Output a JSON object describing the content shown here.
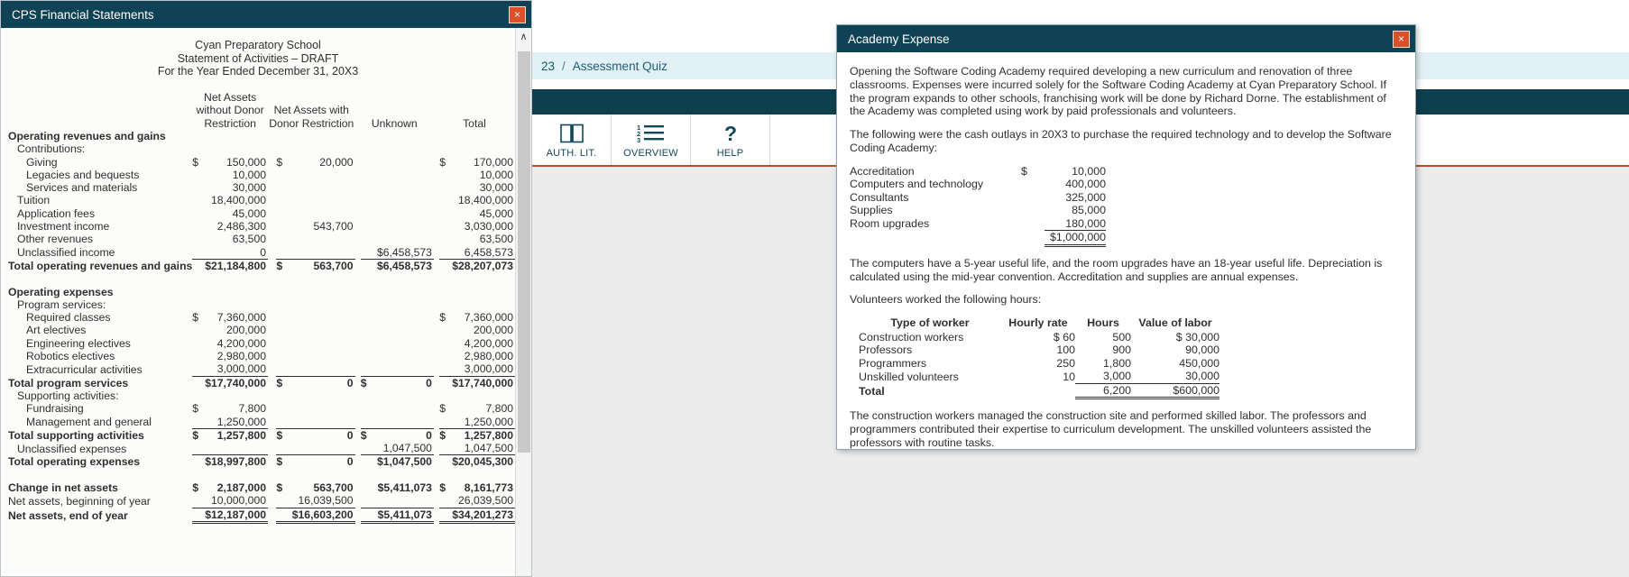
{
  "background_app": {
    "breadcrumb": {
      "prefix": "23",
      "separator": "/",
      "current": "Assessment Quiz"
    },
    "toolbar": {
      "buttons": [
        {
          "icon": "open-book-icon",
          "label": "AUTH. LIT."
        },
        {
          "icon": "numbered-list-icon",
          "label": "OVERVIEW"
        },
        {
          "icon": "question-mark-icon",
          "label": "HELP"
        }
      ]
    },
    "accent_color": "#b8522a",
    "navbar_color": "#0d3f4f"
  },
  "financial_window": {
    "title": "CPS Financial Statements",
    "close_label": "×",
    "scroll_up_glyph": "∧",
    "heading": [
      "Cyan Preparatory School",
      "Statement of Activities – DRAFT",
      "For the Year Ended December 31, 20X3"
    ],
    "column_headers": {
      "col1_line1": "Net Assets",
      "col1_line2": "without Donor",
      "col1_line3": "Restriction",
      "col2_line2": "Net Assets with",
      "col2_line3": "Donor Restriction",
      "col3": "Unknown",
      "col4": "Total"
    },
    "rows": [
      {
        "type": "section",
        "label": "Operating revenues and gains",
        "indent": 0,
        "bold": true
      },
      {
        "type": "sub",
        "label": "Contributions:",
        "indent": 1,
        "bold": false
      },
      {
        "type": "data",
        "label": "Giving",
        "indent": 2,
        "bold": false,
        "c1_sym": "$",
        "c1": "150,000",
        "c2_sym": "$",
        "c2": "20,000",
        "c3_sym": "",
        "c3": "",
        "c4_sym": "$",
        "c4": "170,000"
      },
      {
        "type": "data",
        "label": "Legacies and bequests",
        "indent": 2,
        "bold": false,
        "c1_sym": "",
        "c1": "10,000",
        "c2_sym": "",
        "c2": "",
        "c3_sym": "",
        "c3": "",
        "c4_sym": "",
        "c4": "10,000"
      },
      {
        "type": "data",
        "label": "Services and materials",
        "indent": 2,
        "bold": false,
        "c1_sym": "",
        "c1": "30,000",
        "c2_sym": "",
        "c2": "",
        "c3_sym": "",
        "c3": "",
        "c4_sym": "",
        "c4": "30,000"
      },
      {
        "type": "data",
        "label": "Tuition",
        "indent": 1,
        "bold": false,
        "c1_sym": "",
        "c1": "18,400,000",
        "c2_sym": "",
        "c2": "",
        "c3_sym": "",
        "c3": "",
        "c4_sym": "",
        "c4": "18,400,000"
      },
      {
        "type": "data",
        "label": "Application fees",
        "indent": 1,
        "bold": false,
        "c1_sym": "",
        "c1": "45,000",
        "c2_sym": "",
        "c2": "",
        "c3_sym": "",
        "c3": "",
        "c4_sym": "",
        "c4": "45,000"
      },
      {
        "type": "data",
        "label": "Investment income",
        "indent": 1,
        "bold": false,
        "c1_sym": "",
        "c1": "2,486,300",
        "c2_sym": "",
        "c2": "543,700",
        "c3_sym": "",
        "c3": "",
        "c4_sym": "",
        "c4": "3,030,000"
      },
      {
        "type": "data",
        "label": "Other revenues",
        "indent": 1,
        "bold": false,
        "c1_sym": "",
        "c1": "63,500",
        "c2_sym": "",
        "c2": "",
        "c3_sym": "",
        "c3": "",
        "c4_sym": "",
        "c4": "63,500"
      },
      {
        "type": "data",
        "label": "Unclassified income",
        "indent": 1,
        "bold": false,
        "rule": "below",
        "c1_sym": "",
        "c1": "0",
        "c2_sym": "",
        "c2": "",
        "c3_sym": "",
        "c3": "$6,458,573",
        "c4_sym": "",
        "c4": "6,458,573"
      },
      {
        "type": "total",
        "label": "Total operating revenues and gains",
        "indent": 0,
        "bold": true,
        "rule": "top",
        "c1_sym": "",
        "c1": "$21,184,800",
        "c2_sym": "$",
        "c2": "563,700",
        "c3_sym": "",
        "c3": "$6,458,573",
        "c4_sym": "",
        "c4": "$28,207,073"
      },
      {
        "type": "spacer"
      },
      {
        "type": "section",
        "label": "Operating expenses",
        "indent": 0,
        "bold": true
      },
      {
        "type": "sub",
        "label": "Program services:",
        "indent": 1,
        "bold": false
      },
      {
        "type": "data",
        "label": "Required classes",
        "indent": 2,
        "bold": false,
        "c1_sym": "$",
        "c1": "7,360,000",
        "c2_sym": "",
        "c2": "",
        "c3_sym": "",
        "c3": "",
        "c4_sym": "$",
        "c4": "7,360,000"
      },
      {
        "type": "data",
        "label": "Art electives",
        "indent": 2,
        "bold": false,
        "c1_sym": "",
        "c1": "200,000",
        "c2_sym": "",
        "c2": "",
        "c3_sym": "",
        "c3": "",
        "c4_sym": "",
        "c4": "200,000"
      },
      {
        "type": "data",
        "label": "Engineering electives",
        "indent": 2,
        "bold": false,
        "c1_sym": "",
        "c1": "4,200,000",
        "c2_sym": "",
        "c2": "",
        "c3_sym": "",
        "c3": "",
        "c4_sym": "",
        "c4": "4,200,000"
      },
      {
        "type": "data",
        "label": "Robotics electives",
        "indent": 2,
        "bold": false,
        "c1_sym": "",
        "c1": "2,980,000",
        "c2_sym": "",
        "c2": "",
        "c3_sym": "",
        "c3": "",
        "c4_sym": "",
        "c4": "2,980,000"
      },
      {
        "type": "data",
        "label": "Extracurricular activities",
        "indent": 2,
        "bold": false,
        "c1_sym": "",
        "c1": "3,000,000",
        "c2_sym": "",
        "c2": "",
        "c3_sym": "",
        "c3": "",
        "c4_sym": "",
        "c4": "3,000,000"
      },
      {
        "type": "total",
        "label": "Total program services",
        "indent": 0,
        "bold": true,
        "rule": "top",
        "c1_sym": "",
        "c1": "$17,740,000",
        "c2_sym": "$",
        "c2": "0",
        "c3_sym": "$",
        "c3": "0",
        "c4_sym": "",
        "c4": "$17,740,000"
      },
      {
        "type": "sub",
        "label": "Supporting activities:",
        "indent": 1,
        "bold": false
      },
      {
        "type": "data",
        "label": "Fundraising",
        "indent": 2,
        "bold": false,
        "c1_sym": "$",
        "c1": "7,800",
        "c2_sym": "",
        "c2": "",
        "c3_sym": "",
        "c3": "",
        "c4_sym": "$",
        "c4": "7,800"
      },
      {
        "type": "data",
        "label": "Management and general",
        "indent": 2,
        "bold": false,
        "c1_sym": "",
        "c1": "1,250,000",
        "c2_sym": "",
        "c2": "",
        "c3_sym": "",
        "c3": "",
        "c4_sym": "",
        "c4": "1,250,000"
      },
      {
        "type": "total",
        "label": "Total supporting activities",
        "indent": 0,
        "bold": true,
        "rule": "top",
        "c1_sym": "$",
        "c1": "1,257,800",
        "c2_sym": "$",
        "c2": "0",
        "c3_sym": "$",
        "c3": "0",
        "c4_sym": "$",
        "c4": "1,257,800"
      },
      {
        "type": "data",
        "label": "Unclassified expenses",
        "indent": 1,
        "bold": false,
        "c1_sym": "",
        "c1": "",
        "c2_sym": "",
        "c2": "",
        "c3_sym": "",
        "c3": "1,047,500",
        "c4_sym": "",
        "c4": "1,047,500"
      },
      {
        "type": "total",
        "label": "Total operating expenses",
        "indent": 0,
        "bold": true,
        "rule": "top",
        "c1_sym": "",
        "c1": "$18,997,800",
        "c2_sym": "$",
        "c2": "0",
        "c3_sym": "",
        "c3": "$1,047,500",
        "c4_sym": "",
        "c4": "$20,045,300"
      },
      {
        "type": "spacer"
      },
      {
        "type": "total",
        "label": "Change in net assets",
        "indent": 0,
        "bold": true,
        "c1_sym": "$",
        "c1": "2,187,000",
        "c2_sym": "$",
        "c2": "563,700",
        "c3_sym": "",
        "c3": "$5,411,073",
        "c4_sym": "$",
        "c4": "8,161,773"
      },
      {
        "type": "data",
        "label": "Net assets, beginning of year",
        "indent": 0,
        "bold": false,
        "c1_sym": "",
        "c1": "10,000,000",
        "c2_sym": "",
        "c2": "16,039,500",
        "c3_sym": "",
        "c3": "",
        "c4_sym": "",
        "c4": "26,039,500"
      },
      {
        "type": "grand",
        "label": "Net assets, end of year",
        "indent": 0,
        "bold": true,
        "rule": "topdbl",
        "c1_sym": "",
        "c1": "$12,187,000",
        "c2_sym": "",
        "c2": "$16,603,200",
        "c3_sym": "",
        "c3": "$5,411,073",
        "c4_sym": "",
        "c4": "$34,201,273"
      }
    ]
  },
  "dialog": {
    "title": "Academy Expense",
    "close_label": "×",
    "paragraphs": [
      "Opening the Software Coding Academy required developing a new curriculum and renovation of three classrooms. Expenses were incurred solely for the Software Coding Academy at Cyan Preparatory School. If the program expands to other schools, franchising work will be done by Richard Dorne. The establishment of the Academy was completed using work by paid professionals and volunteers.",
      "The following were the cash outlays in 20X3 to purchase the required technology and to develop the Software Coding Academy:"
    ],
    "outlays": [
      {
        "label": "Accreditation",
        "sym": "$",
        "amount": "10,000"
      },
      {
        "label": "Computers and technology",
        "sym": "",
        "amount": "400,000"
      },
      {
        "label": "Consultants",
        "sym": "",
        "amount": "325,000"
      },
      {
        "label": "Supplies",
        "sym": "",
        "amount": "85,000"
      },
      {
        "label": "Room upgrades",
        "sym": "",
        "amount": "180,000"
      }
    ],
    "outlays_total": "$1,000,000",
    "paragraph_depreciation": "The computers have a 5-year useful life, and the room upgrades have an 18-year useful life. Depreciation is calculated using the mid-year convention. Accreditation and supplies are annual expenses.",
    "paragraph_volunteers": "Volunteers worked the following hours:",
    "volunteer_headers": {
      "type": "Type of worker",
      "rate": "Hourly rate",
      "hours": "Hours",
      "value": "Value of labor"
    },
    "volunteers": [
      {
        "type": "Construction workers",
        "rate_sym": "$",
        "rate": "60",
        "hours": "500",
        "value_sym": "$",
        "value": "30,000"
      },
      {
        "type": "Professors",
        "rate_sym": "",
        "rate": "100",
        "hours": "900",
        "value_sym": "",
        "value": "90,000"
      },
      {
        "type": "Programmers",
        "rate_sym": "",
        "rate": "250",
        "hours": "1,800",
        "value_sym": "",
        "value": "450,000"
      },
      {
        "type": "Unskilled volunteers",
        "rate_sym": "",
        "rate": "10",
        "hours": "3,000",
        "value_sym": "",
        "value": "30,000"
      }
    ],
    "volunteer_total": {
      "label": "Total",
      "hours": "6,200",
      "value": "$600,000"
    },
    "paragraph_closing": "The construction workers managed the construction site and performed skilled labor. The professors and programmers contributed their expertise to curriculum development. The unskilled volunteers assisted the professors with routine tasks."
  }
}
